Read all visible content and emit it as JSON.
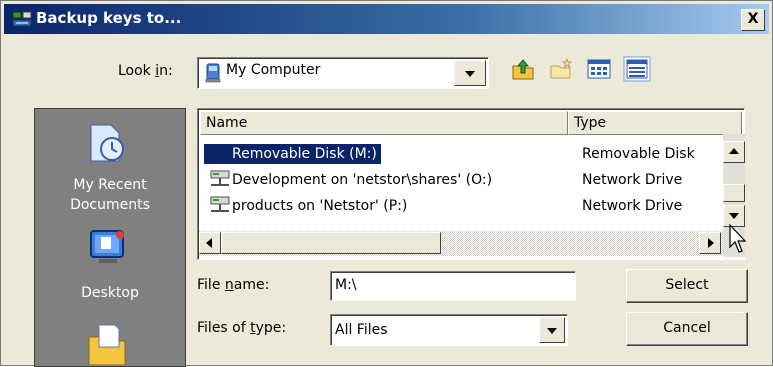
{
  "window": {
    "title": "Backup keys to..."
  },
  "look_in": {
    "label_before": "Look ",
    "label_key": "i",
    "label_after": "n:",
    "value": "My Computer"
  },
  "toolbar": {
    "icons": [
      "up-folder-icon",
      "new-folder-icon",
      "list-view-icon",
      "details-view-icon"
    ]
  },
  "places": {
    "items": [
      {
        "icon": "recent-documents-icon",
        "label_line1": "My Recent",
        "label_line2": "Documents"
      },
      {
        "icon": "desktop-icon",
        "label_line1": "Desktop",
        "label_line2": ""
      },
      {
        "icon": "my-documents-icon",
        "label_line1": "",
        "label_line2": ""
      }
    ]
  },
  "file_list": {
    "columns": [
      "Name",
      "Type"
    ],
    "rows": [
      {
        "name": "Removable Disk (M:)",
        "type": "Removable Disk",
        "icon": "removable-disk-icon",
        "selected": true
      },
      {
        "name": "Development on 'netstor\\shares' (O:)",
        "type": "Network Drive",
        "icon": "network-drive-icon",
        "selected": false
      },
      {
        "name": "products on 'Netstor' (P:)",
        "type": "Network Drive",
        "icon": "network-drive-icon",
        "selected": false
      }
    ]
  },
  "file_name": {
    "label_before": "File ",
    "label_key": "n",
    "label_after": "ame:",
    "value": "M:\\"
  },
  "file_type": {
    "label_before": "Files of ",
    "label_key": "t",
    "label_after": "ype:",
    "value": "All Files"
  },
  "buttons": {
    "select": "Select",
    "cancel": "Cancel",
    "close": "X"
  },
  "colors": {
    "title_start": "#0a246a",
    "selection": "#0a246a",
    "dialog_bg": "#ece9d8",
    "places_bg": "#808080"
  }
}
